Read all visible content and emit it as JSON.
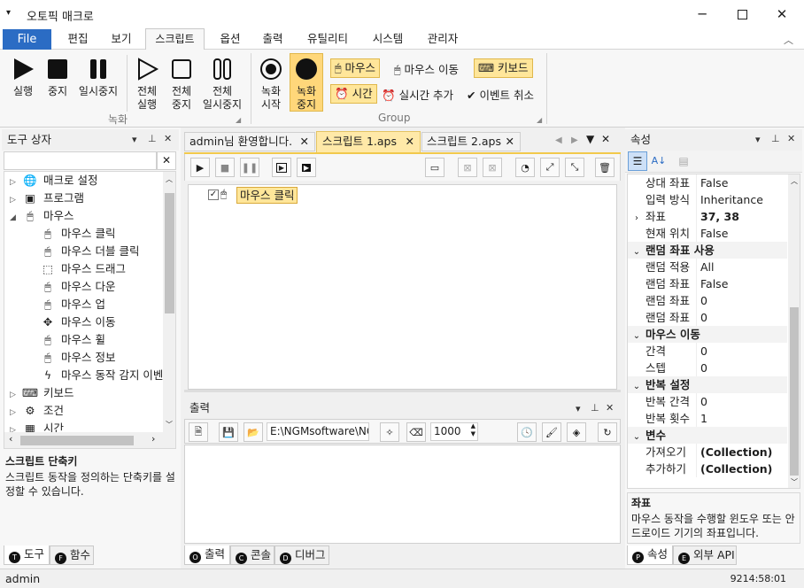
{
  "window": {
    "title": "오토픽 매크로",
    "min_icon": "minimize-icon",
    "max_icon": "maximize-icon",
    "close_icon": "close-icon"
  },
  "menu": {
    "file": "File",
    "tabs": [
      "편집",
      "보기",
      "스크립트",
      "옵션",
      "출력",
      "유틸리티",
      "시스템",
      "관리자"
    ]
  },
  "ribbon": {
    "run": "실행",
    "stop": "중지",
    "pause": "일시중지",
    "all_run": [
      "전체",
      "실행"
    ],
    "all_stop": [
      "전체",
      "중지"
    ],
    "all_pause": [
      "전체",
      "일시중지"
    ],
    "group_record": "녹화",
    "rec_start": [
      "녹화",
      "시작"
    ],
    "rec_stop": [
      "녹화",
      "중지"
    ],
    "mouse": "마우스",
    "mouse_move": "마우스 이동",
    "keyboard": "키보드",
    "time": "시간",
    "realtime_add": "실시간 추가",
    "event_cancel": "이벤트 취소",
    "group_group": "Group"
  },
  "toolbox": {
    "title": "도구 상자",
    "search_value": "",
    "items": [
      {
        "label": "매크로 설정",
        "icon": "globe-icon",
        "level": 0,
        "expander": "collapsed"
      },
      {
        "label": "프로그램",
        "icon": "program-icon",
        "level": 0,
        "expander": "collapsed"
      },
      {
        "label": "마우스",
        "icon": "mouse-icon",
        "level": 0,
        "expander": "expanded"
      },
      {
        "label": "마우스 클릭",
        "icon": "mouse-click-icon",
        "level": 1
      },
      {
        "label": "마우스 더블 클릭",
        "icon": "mouse-double-click-icon",
        "level": 1
      },
      {
        "label": "마우스 드래그",
        "icon": "mouse-drag-icon",
        "level": 1
      },
      {
        "label": "마우스 다운",
        "icon": "mouse-down-icon",
        "level": 1
      },
      {
        "label": "마우스 업",
        "icon": "mouse-up-icon",
        "level": 1
      },
      {
        "label": "마우스 이동",
        "icon": "move-arrows-icon",
        "level": 1
      },
      {
        "label": "마우스 휠",
        "icon": "mouse-wheel-icon",
        "level": 1
      },
      {
        "label": "마우스 정보",
        "icon": "mouse-info-icon",
        "level": 1
      },
      {
        "label": "마우스 동작 감지 이벤",
        "icon": "lightning-icon",
        "level": 1
      },
      {
        "label": "키보드",
        "icon": "keyboard-icon",
        "level": 0,
        "expander": "collapsed"
      },
      {
        "label": "조건",
        "icon": "condition-icon",
        "level": 0,
        "expander": "collapsed"
      },
      {
        "label": "시간",
        "icon": "calendar-icon",
        "level": 0,
        "expander": "collapsed"
      }
    ],
    "desc_title": "스크립트 단축키",
    "desc_text": "스크립트 동작을 정의하는 단축키를 설정할 수 있습니다.",
    "tabs": [
      "도구",
      "함수"
    ]
  },
  "editor": {
    "tabs": [
      "admin님 환영합니다.",
      "스크립트 1.aps",
      "스크립트 2.aps"
    ],
    "script_line": "마우스 클릭"
  },
  "output": {
    "title": "출력",
    "path": "E:\\NGMsoftware\\NG",
    "interval": "1000",
    "tabs": [
      "출력",
      "콘솔",
      "디버그"
    ]
  },
  "properties": {
    "title": "속성",
    "rows": [
      {
        "type": "row",
        "name": "상대 좌표",
        "value": "False"
      },
      {
        "type": "row",
        "name": "입력 방식",
        "value": "Inheritance"
      },
      {
        "type": "row",
        "name": "좌표",
        "value": "37, 38",
        "bold": true,
        "expander": true
      },
      {
        "type": "row",
        "name": "현재 위치",
        "value": "False"
      },
      {
        "type": "section",
        "name": "랜덤 좌표 사용"
      },
      {
        "type": "row",
        "name": "랜덤 적용",
        "value": "All"
      },
      {
        "type": "row",
        "name": "랜덤 좌표",
        "value": "False"
      },
      {
        "type": "row",
        "name": "랜덤 좌표",
        "value": "0"
      },
      {
        "type": "row",
        "name": "랜덤 좌표",
        "value": "0"
      },
      {
        "type": "section",
        "name": "마우스 이동"
      },
      {
        "type": "row",
        "name": "간격",
        "value": "0"
      },
      {
        "type": "row",
        "name": "스텝",
        "value": "0"
      },
      {
        "type": "section",
        "name": "반복 설정"
      },
      {
        "type": "row",
        "name": "반복 간격",
        "value": "0"
      },
      {
        "type": "row",
        "name": "반복 횟수",
        "value": "1"
      },
      {
        "type": "section",
        "name": "변수"
      },
      {
        "type": "row",
        "name": "가져오기",
        "value": "(Collection)",
        "bold": true
      },
      {
        "type": "row",
        "name": "추가하기",
        "value": "(Collection)",
        "bold": true
      }
    ],
    "desc_title": "좌표",
    "desc_text": "마우스 동작을 수행할 윈도우 또는 안드로이드 기기의 좌표입니다.",
    "tabs": [
      "속성",
      "외부 API"
    ]
  },
  "status": {
    "user": "admin",
    "time": "9214:58:01"
  },
  "colors": {
    "file_blue": "#2b6cc4",
    "highlight": "#ffe69a",
    "highlight_border": "#e0b84c"
  }
}
